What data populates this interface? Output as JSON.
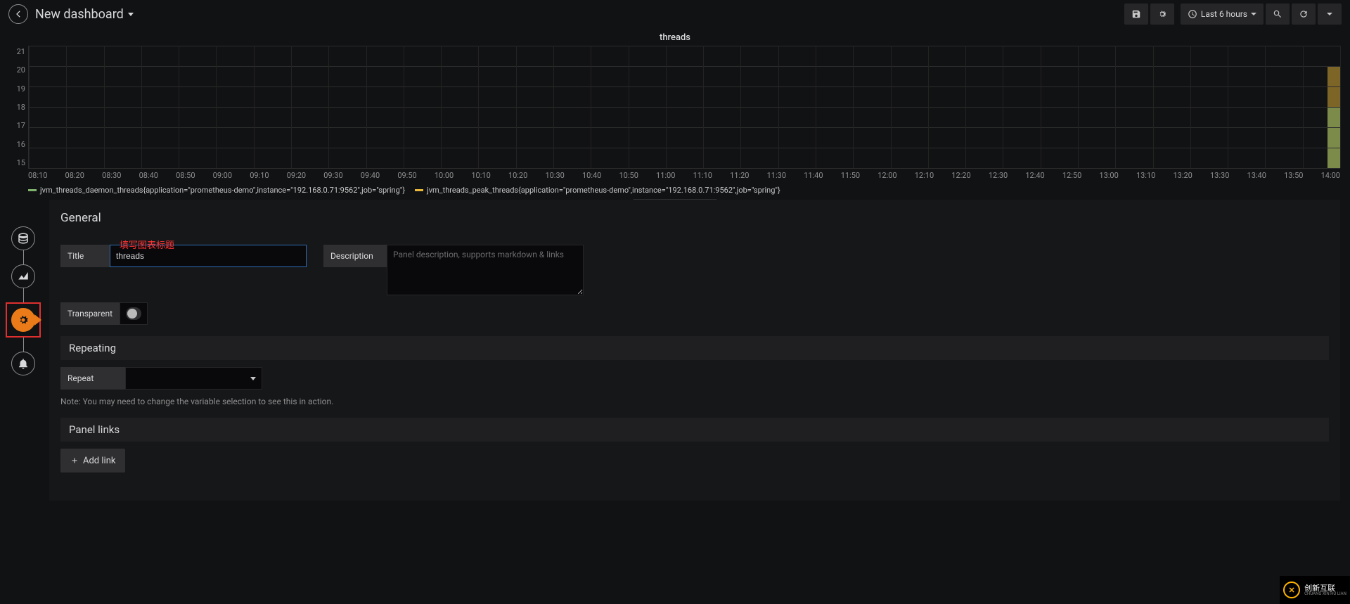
{
  "header": {
    "title": "New dashboard",
    "time_range_label": "Last 6 hours"
  },
  "chart_data": {
    "type": "bar",
    "title": "threads",
    "xlabel": "",
    "ylabel": "",
    "categories": [
      "08:10",
      "08:20",
      "08:30",
      "08:40",
      "08:50",
      "09:00",
      "09:10",
      "09:20",
      "09:30",
      "09:40",
      "09:50",
      "10:00",
      "10:10",
      "10:20",
      "10:30",
      "10:40",
      "10:50",
      "11:00",
      "11:10",
      "11:20",
      "11:30",
      "11:40",
      "11:50",
      "12:00",
      "12:10",
      "12:20",
      "12:30",
      "12:40",
      "12:50",
      "13:00",
      "13:10",
      "13:20",
      "13:30",
      "13:40",
      "13:50",
      "14:00"
    ],
    "y_ticks": [
      21,
      20,
      19,
      18,
      17,
      16,
      15
    ],
    "ylim": [
      15,
      21
    ],
    "series": [
      {
        "name": "jvm_threads_daemon_threads{application=\"prometheus-demo\",instance=\"192.168.0.71:9562\",job=\"spring\"}",
        "color": "#7eb26d",
        "values_at_last_tick": 18
      },
      {
        "name": "jvm_threads_peak_threads{application=\"prometheus-demo\",instance=\"192.168.0.71:9562\",job=\"spring\"}",
        "color": "#eab839",
        "values_at_last_tick": 20
      }
    ]
  },
  "annotation": "填写图表标题",
  "editor": {
    "general": {
      "header": "General",
      "fields": {
        "title_label": "Title",
        "title_value": "threads",
        "transparent_label": "Transparent",
        "transparent_on": false,
        "description_label": "Description",
        "description_value": "",
        "description_placeholder": "Panel description, supports markdown & links"
      }
    },
    "repeating": {
      "header": "Repeating",
      "repeat_label": "Repeat",
      "repeat_value": "",
      "note": "Note: You may need to change the variable selection to see this in action."
    },
    "links": {
      "header": "Panel links",
      "add_link_label": "Add link"
    }
  },
  "side_rail": {
    "items": [
      "queries",
      "visualization",
      "general",
      "alert"
    ],
    "active": "general"
  },
  "watermark": {
    "brand": "创新互联",
    "sub": "CHUANG XIN HU LIAN"
  }
}
